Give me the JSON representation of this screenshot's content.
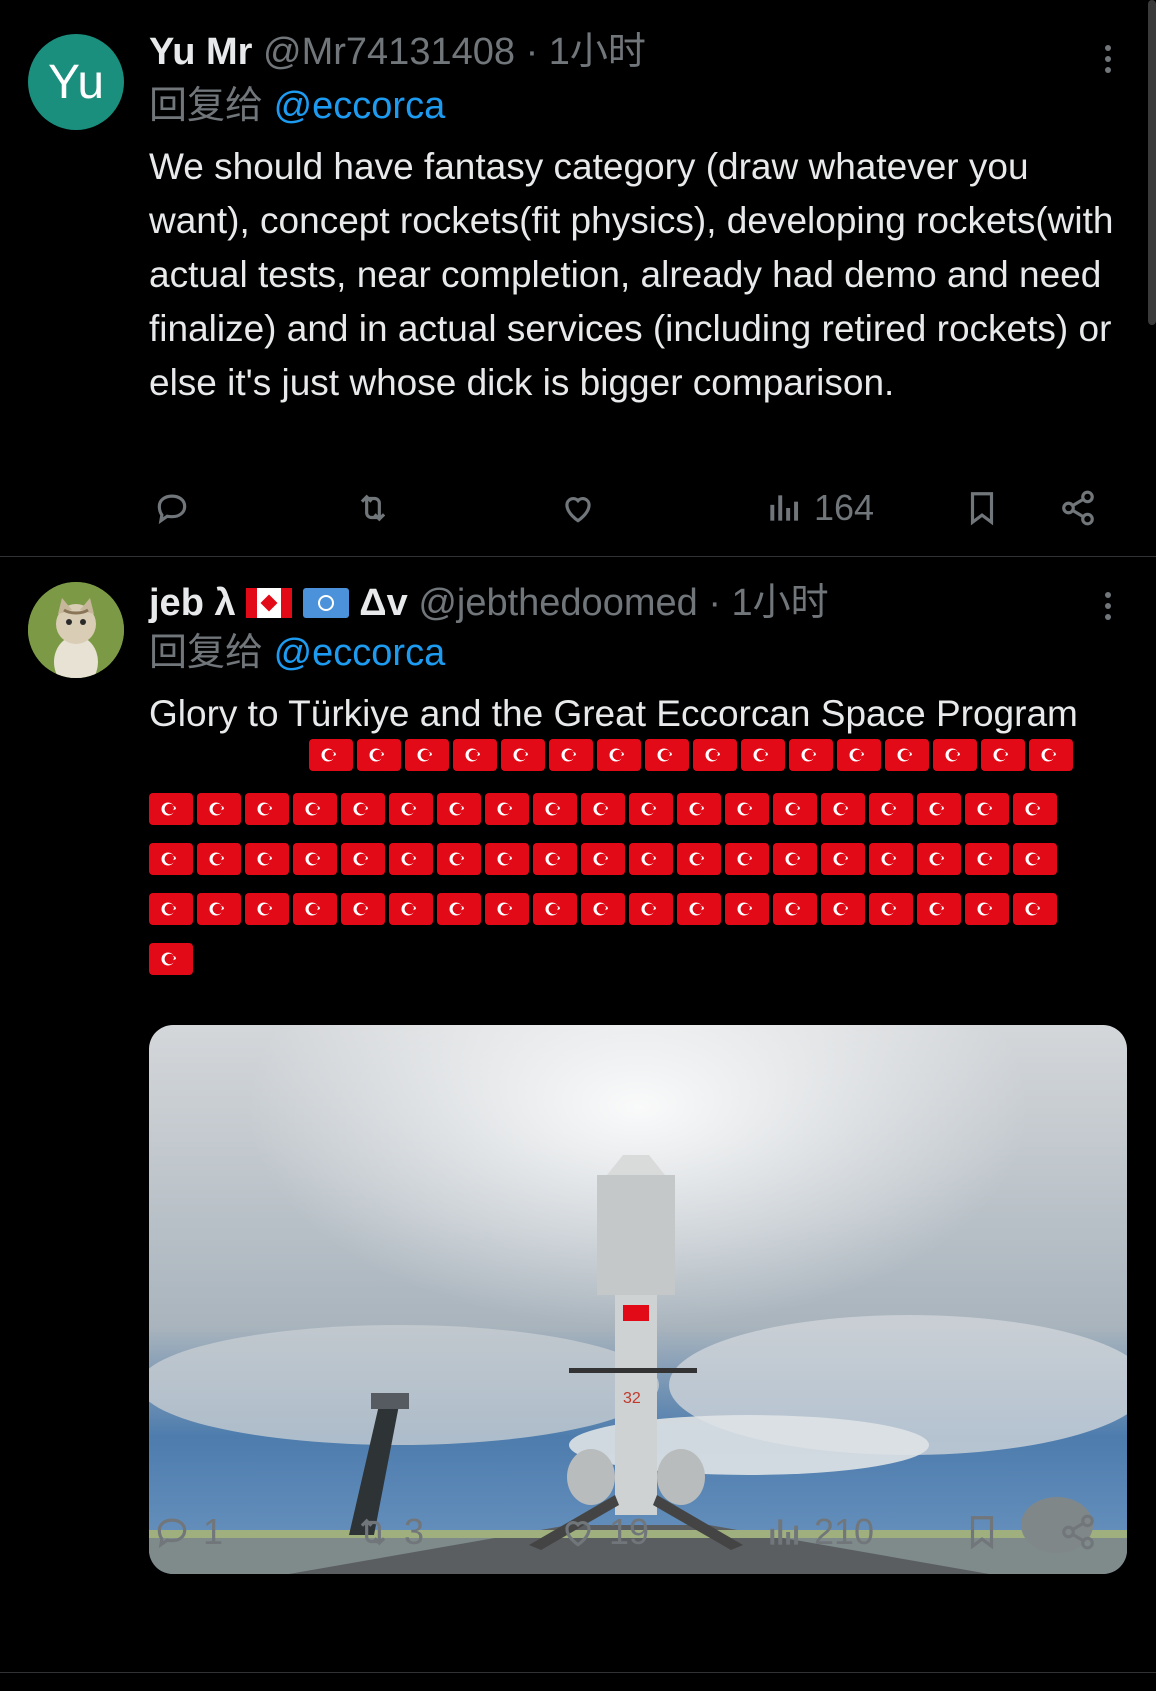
{
  "tweets": [
    {
      "avatar_text": "Yu",
      "name": "Yu Mr",
      "handle": "@Mr74131408",
      "sep": "·",
      "time": "1小时",
      "reply_prefix": "回复给",
      "reply_to": "@eccorca",
      "text": "We should have fantasy category (draw whatever you want), concept rockets(fit physics), developing rockets(with actual tests, near completion, already had demo and need finalize) and in actual services (including retired rockets) or else it's just whose dick is bigger comparison.",
      "actions": {
        "reply": "",
        "retweet": "",
        "like": "",
        "views": "164"
      }
    },
    {
      "name": "jeb λ",
      "name_suffix": "Δv",
      "handle": "@jebthedoomed",
      "sep": "·",
      "time": "1小时",
      "reply_prefix": "回复给",
      "reply_to": "@eccorca",
      "text": "Glory to Türkiye and the Great Eccorcan Space Program",
      "media_label": "32",
      "actions": {
        "reply": "1",
        "retweet": "3",
        "like": "19",
        "views": "210"
      }
    }
  ],
  "icons": {
    "reply": "speech-bubble-icon",
    "retweet": "retweet-arrows-icon",
    "like": "heart-icon",
    "views": "bar-chart-icon",
    "bookmark": "bookmark-icon",
    "share": "share-icon",
    "more": "three-dots-icon"
  },
  "colors": {
    "background": "#000000",
    "text": "#e7e9ea",
    "muted": "#71767b",
    "link": "#1d9bf0",
    "flag_red": "#e30a17"
  }
}
